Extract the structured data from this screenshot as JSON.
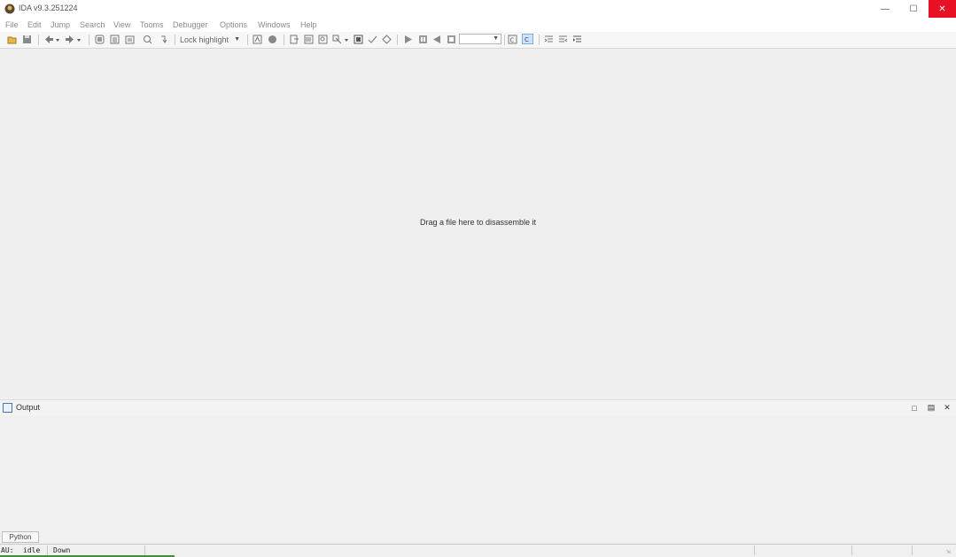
{
  "window": {
    "title": "IDA v9.3.251224",
    "icon": "ida-logo-icon",
    "controls": [
      "minimize-icon",
      "maximize-icon",
      "close-icon"
    ]
  },
  "menu": [
    "File",
    "Edit",
    "Jump",
    "Search",
    "View",
    "Tooms",
    "Debugger",
    "Options",
    "Windows",
    "Help"
  ],
  "toolbar": {
    "lock_highlight": "Lock highlight",
    "address_value": ""
  },
  "main": {
    "hint": "Drag a file here to disassemble it"
  },
  "output": {
    "title": "Output",
    "text": ""
  },
  "cli": {
    "language": "Python"
  },
  "status": {
    "au_label": "AU:",
    "au_state": "idle",
    "direction": "Down"
  },
  "colors": {
    "close_button": "#e81123",
    "background": "#f0f0f0",
    "menu_text": "#8a8a8a"
  }
}
